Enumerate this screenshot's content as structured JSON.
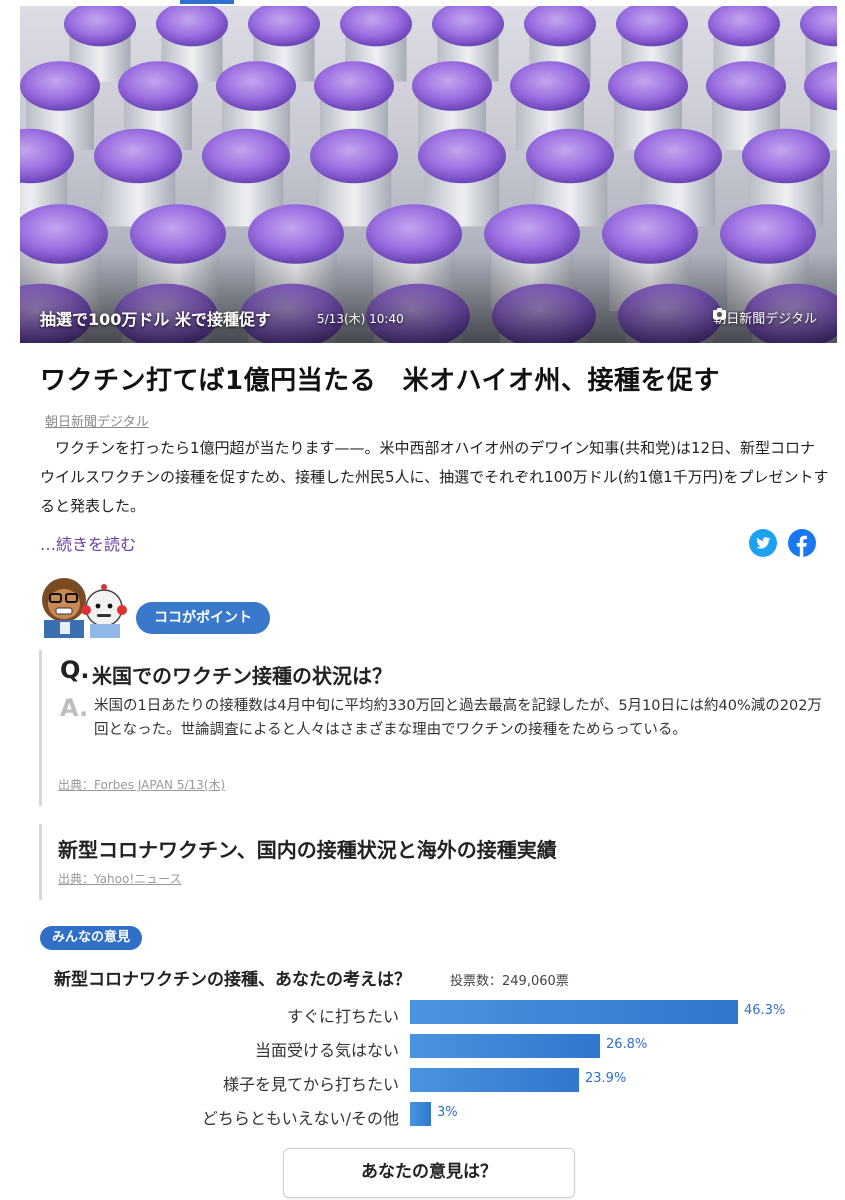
{
  "hero": {
    "caption": "抽選で100万ドル 米で接種促す",
    "timestamp": "5/13(木) 10:40",
    "source": "朝日新聞デジタル",
    "icon": "camera-icon"
  },
  "article": {
    "headline": "ワクチン打てば1億円当たる　米オハイオ州、接種を促す",
    "publisher": "朝日新聞デジタル",
    "summary": "　ワクチンを打ったら1億円超が当たります——。米中西部オハイオ州のデワイン知事(共和党)は12日、新型コロナウイルスワクチンの接種を促すため、接種した州民5人に、抽選でそれぞれ100万ドル(約1億1千万円)をプレゼントすると発表した。",
    "read_more": "…続きを読む",
    "share": [
      {
        "icon": "twitter-icon",
        "color": "#1da1f2"
      },
      {
        "icon": "facebook-icon",
        "color": "#1877f2"
      }
    ]
  },
  "point": {
    "label": "ココがポイント",
    "q_mark": "Q.",
    "question": "米国でのワクチン接種の状況は？",
    "a_mark": "A.",
    "answer": "米国の1日あたりの接種数は4月中旬に平均約330万回と過去最高を記録したが、5月10日には約40%減の202万回となった。世論調査によると人々はさまざまな理由でワクチンの接種をためらっている。",
    "credit": "出典：Forbes JAPAN 5/13(木)"
  },
  "related": {
    "title": "新型コロナワクチン、国内の接種状況と海外の接種実績",
    "credit": "出典：Yahoo!ニュース"
  },
  "poll": {
    "badge": "みんなの意見",
    "question": "新型コロナワクチンの接種、あなたの考えは？",
    "votes": "投票数：249,060票",
    "options": [
      {
        "label": "すぐに打ちたい",
        "percent": 46.3,
        "percent_text": "46.3%"
      },
      {
        "label": "当面受ける気はない",
        "percent": 26.8,
        "percent_text": "26.8%"
      },
      {
        "label": "様子を見てから打ちたい",
        "percent": 23.9,
        "percent_text": "23.9%"
      },
      {
        "label": "どちらともいえない/その他",
        "percent": 3,
        "percent_text": "3%"
      }
    ],
    "cta": "あなたの意見は？",
    "bar_color": "#2f77cf"
  }
}
